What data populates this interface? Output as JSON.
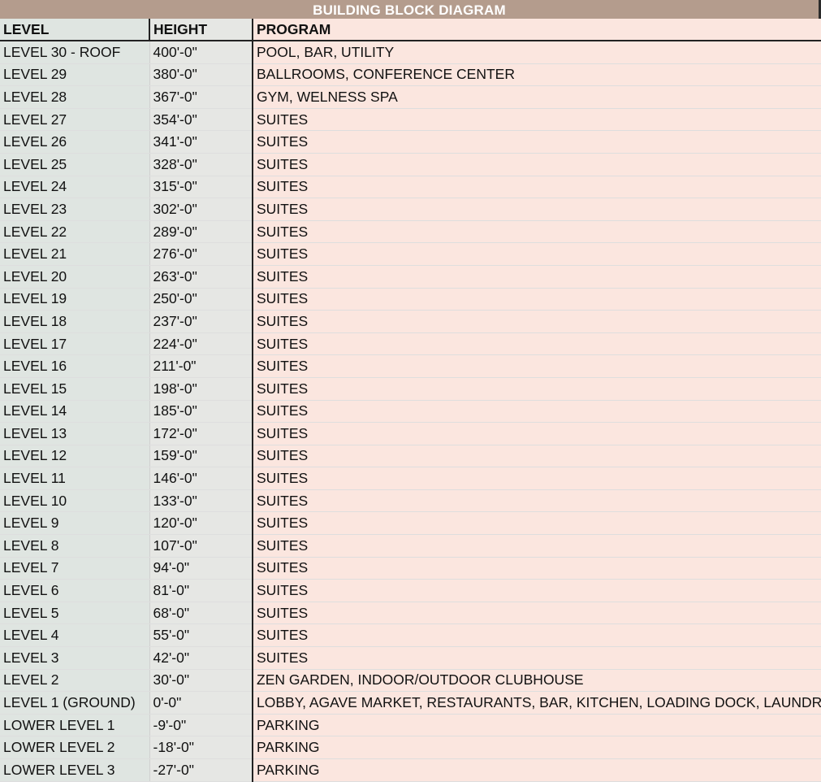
{
  "title": "BUILDING BLOCK DIAGRAM",
  "headers": {
    "level": "LEVEL",
    "height": "HEIGHT",
    "program": "PROGRAM"
  },
  "colors": {
    "title_bar": "#b49c8d",
    "level_column": "#dfe5e1",
    "height_column": "#e6e7e4",
    "program_column": "#fbe6df"
  },
  "rows": [
    {
      "level": "LEVEL 30 - ROOF",
      "height": "400'-0\"",
      "program": "POOL, BAR, UTILITY"
    },
    {
      "level": "LEVEL 29",
      "height": "380'-0\"",
      "program": "BALLROOMS, CONFERENCE CENTER"
    },
    {
      "level": "LEVEL 28",
      "height": "367'-0\"",
      "program": "GYM, WELNESS SPA"
    },
    {
      "level": "LEVEL 27",
      "height": "354'-0\"",
      "program": "SUITES"
    },
    {
      "level": "LEVEL 26",
      "height": "341'-0\"",
      "program": "SUITES"
    },
    {
      "level": "LEVEL 25",
      "height": "328'-0\"",
      "program": "SUITES"
    },
    {
      "level": "LEVEL 24",
      "height": "315'-0\"",
      "program": "SUITES"
    },
    {
      "level": "LEVEL 23",
      "height": "302'-0\"",
      "program": "SUITES"
    },
    {
      "level": "LEVEL 22",
      "height": "289'-0\"",
      "program": "SUITES"
    },
    {
      "level": "LEVEL 21",
      "height": "276'-0\"",
      "program": "SUITES"
    },
    {
      "level": "LEVEL 20",
      "height": "263'-0\"",
      "program": "SUITES"
    },
    {
      "level": "LEVEL 19",
      "height": "250'-0\"",
      "program": "SUITES"
    },
    {
      "level": "LEVEL 18",
      "height": "237'-0\"",
      "program": "SUITES"
    },
    {
      "level": "LEVEL 17",
      "height": "224'-0\"",
      "program": "SUITES"
    },
    {
      "level": "LEVEL 16",
      "height": "211'-0\"",
      "program": "SUITES"
    },
    {
      "level": "LEVEL 15",
      "height": "198'-0\"",
      "program": "SUITES"
    },
    {
      "level": "LEVEL 14",
      "height": "185'-0\"",
      "program": "SUITES"
    },
    {
      "level": "LEVEL 13",
      "height": "172'-0\"",
      "program": "SUITES"
    },
    {
      "level": "LEVEL 12",
      "height": "159'-0\"",
      "program": "SUITES"
    },
    {
      "level": "LEVEL 11",
      "height": "146'-0\"",
      "program": "SUITES"
    },
    {
      "level": "LEVEL 10",
      "height": "133'-0\"",
      "program": "SUITES"
    },
    {
      "level": "LEVEL 9",
      "height": "120'-0\"",
      "program": "SUITES"
    },
    {
      "level": "LEVEL 8",
      "height": "107'-0\"",
      "program": "SUITES"
    },
    {
      "level": "LEVEL 7",
      "height": "94'-0\"",
      "program": "SUITES"
    },
    {
      "level": "LEVEL 6",
      "height": "81'-0\"",
      "program": "SUITES"
    },
    {
      "level": "LEVEL 5",
      "height": "68'-0\"",
      "program": "SUITES"
    },
    {
      "level": "LEVEL 4",
      "height": "55'-0\"",
      "program": "SUITES"
    },
    {
      "level": "LEVEL 3",
      "height": "42'-0\"",
      "program": "SUITES"
    },
    {
      "level": "LEVEL 2",
      "height": "30'-0\"",
      "program": "ZEN GARDEN, INDOOR/OUTDOOR CLUBHOUSE"
    },
    {
      "level": "LEVEL 1 (GROUND)",
      "height": "0'-0\"",
      "program": "LOBBY, AGAVE MARKET, RESTAURANTS, BAR, KITCHEN, LOADING DOCK, LAUNDRY"
    },
    {
      "level": "LOWER LEVEL 1",
      "height": "-9'-0\"",
      "program": "PARKING"
    },
    {
      "level": "LOWER LEVEL 2",
      "height": "-18'-0\"",
      "program": "PARKING"
    },
    {
      "level": "LOWER LEVEL 3",
      "height": "-27'-0\"",
      "program": "PARKING"
    }
  ]
}
